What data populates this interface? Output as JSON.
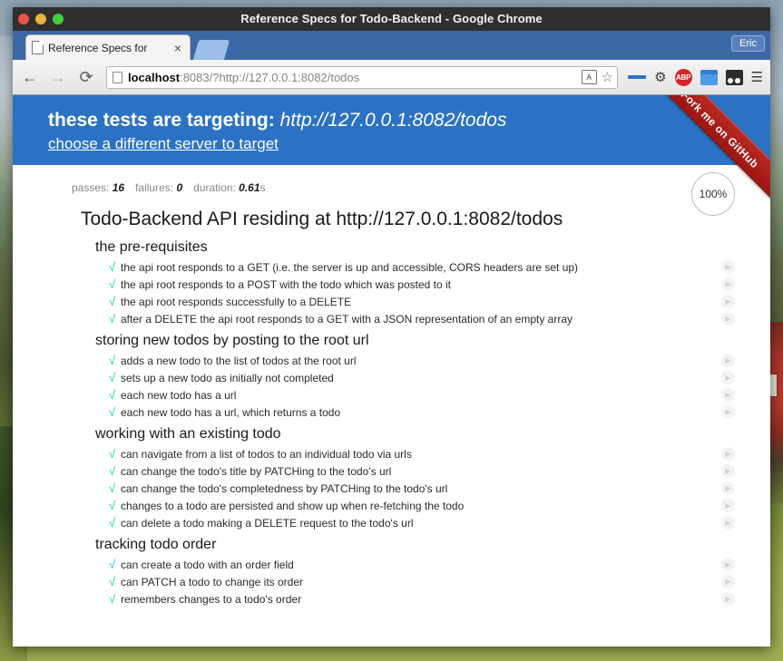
{
  "window": {
    "title": "Reference Specs for Todo-Backend - Google Chrome",
    "traffic_lights": [
      "close",
      "minimize",
      "maximize"
    ]
  },
  "tab": {
    "title": "Reference Specs for",
    "favicon": "page-icon",
    "close_label": "×",
    "new_tab_label": ""
  },
  "user": {
    "name": "Eric"
  },
  "toolbar": {
    "back_label": "←",
    "forward_label": "→",
    "reload_label": "⟳",
    "url_host": "localhost",
    "url_rest": ":8083/?http://127.0.0.1:8082/todos",
    "url_full": "localhost:8083/?http://127.0.0.1:8082/todos",
    "translate_label": "A",
    "star_label": "☆",
    "gear_label": "⚙",
    "abp_label": "ABP",
    "menu_label": "☰"
  },
  "banner": {
    "lead": "these tests are targeting:",
    "target_url": "http://127.0.0.1:8082/todos",
    "link": "choose a different server to target",
    "background_color": "#2b72c4"
  },
  "ribbon": {
    "label": "Fork me on GitHub",
    "color": "#a51d16"
  },
  "stats": {
    "passes_label": "passes:",
    "passes_value": "16",
    "failures_label": "failures:",
    "failures_value": "0",
    "duration_label": "duration:",
    "duration_value": "0.61",
    "duration_unit": "s",
    "progress": "100%"
  },
  "report": {
    "suite_title": "Todo-Backend API residing at http://127.0.0.1:8082/todos",
    "tick_glyph": "√",
    "replay_glyph": "▶",
    "groups": [
      {
        "title": "the pre-requisites",
        "tests": [
          "the api root responds to a GET (i.e. the server is up and accessible, CORS headers are set up)",
          "the api root responds to a POST with the todo which was posted to it",
          "the api root responds successfully to a DELETE",
          "after a DELETE the api root responds to a GET with a JSON representation of an empty array"
        ]
      },
      {
        "title": "storing new todos by posting to the root url",
        "tests": [
          "adds a new todo to the list of todos at the root url",
          "sets up a new todo as initially not completed",
          "each new todo has a url",
          "each new todo has a url, which returns a todo"
        ]
      },
      {
        "title": "working with an existing todo",
        "tests": [
          "can navigate from a list of todos to an individual todo via urls",
          "can change the todo's title by PATCHing to the todo's url",
          "can change the todo's completedness by PATCHing to the todo's url",
          "changes to a todo are persisted and show up when re-fetching the todo",
          "can delete a todo making a DELETE request to the todo's url"
        ]
      },
      {
        "title": "tracking todo order",
        "tests": [
          "can create a todo with an order field",
          "can PATCH a todo to change its order",
          "remembers changes to a todo's order"
        ]
      }
    ]
  }
}
